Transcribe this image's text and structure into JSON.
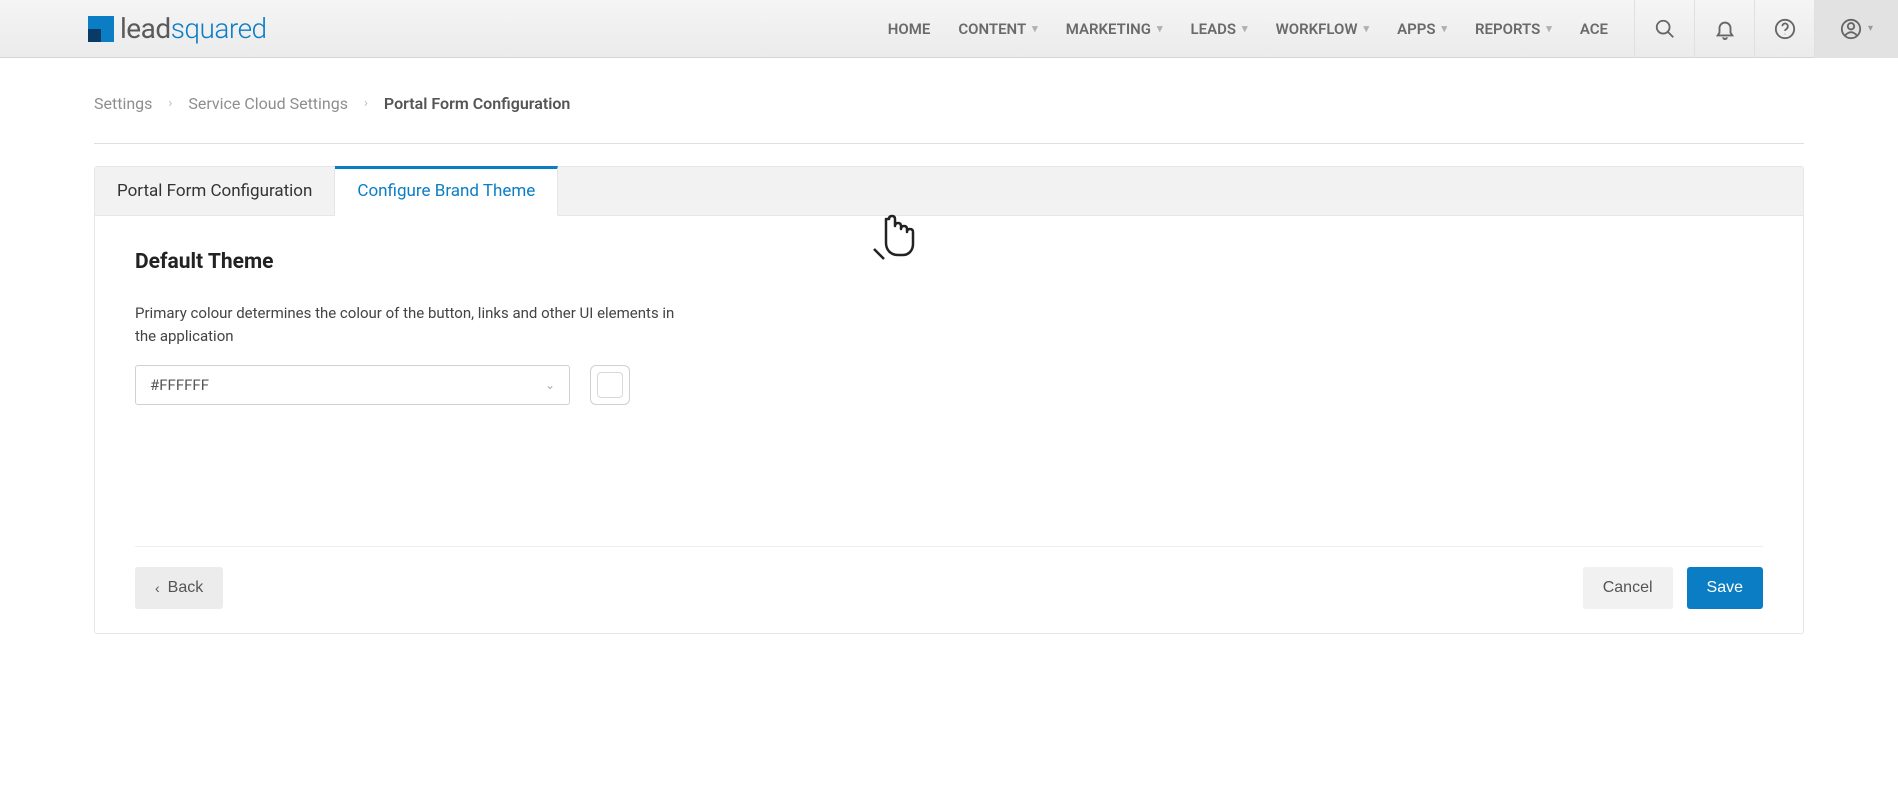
{
  "brand": {
    "name": "leadsquared",
    "prefix": "lead",
    "suffix": "squared"
  },
  "nav": {
    "items": [
      {
        "label": "HOME",
        "dropdown": false
      },
      {
        "label": "CONTENT",
        "dropdown": true
      },
      {
        "label": "MARKETING",
        "dropdown": true
      },
      {
        "label": "LEADS",
        "dropdown": true
      },
      {
        "label": "WORKFLOW",
        "dropdown": true
      },
      {
        "label": "APPS",
        "dropdown": true
      },
      {
        "label": "REPORTS",
        "dropdown": true
      },
      {
        "label": "ACE",
        "dropdown": false
      }
    ]
  },
  "breadcrumb": {
    "items": [
      {
        "label": "Settings",
        "active": false
      },
      {
        "label": "Service Cloud Settings",
        "active": false
      },
      {
        "label": "Portal Form Configuration",
        "active": true
      }
    ]
  },
  "tabs": [
    {
      "label": "Portal Form Configuration",
      "active": false
    },
    {
      "label": "Configure Brand Theme",
      "active": true
    }
  ],
  "theme": {
    "title": "Default Theme",
    "description": "Primary colour determines the colour of the button, links and other UI elements in the application",
    "color_value": "#FFFFFF",
    "swatch_hex": "#FFFFFF"
  },
  "actions": {
    "back": "Back",
    "cancel": "Cancel",
    "save": "Save"
  },
  "colors": {
    "accent": "#0b7dc5"
  }
}
